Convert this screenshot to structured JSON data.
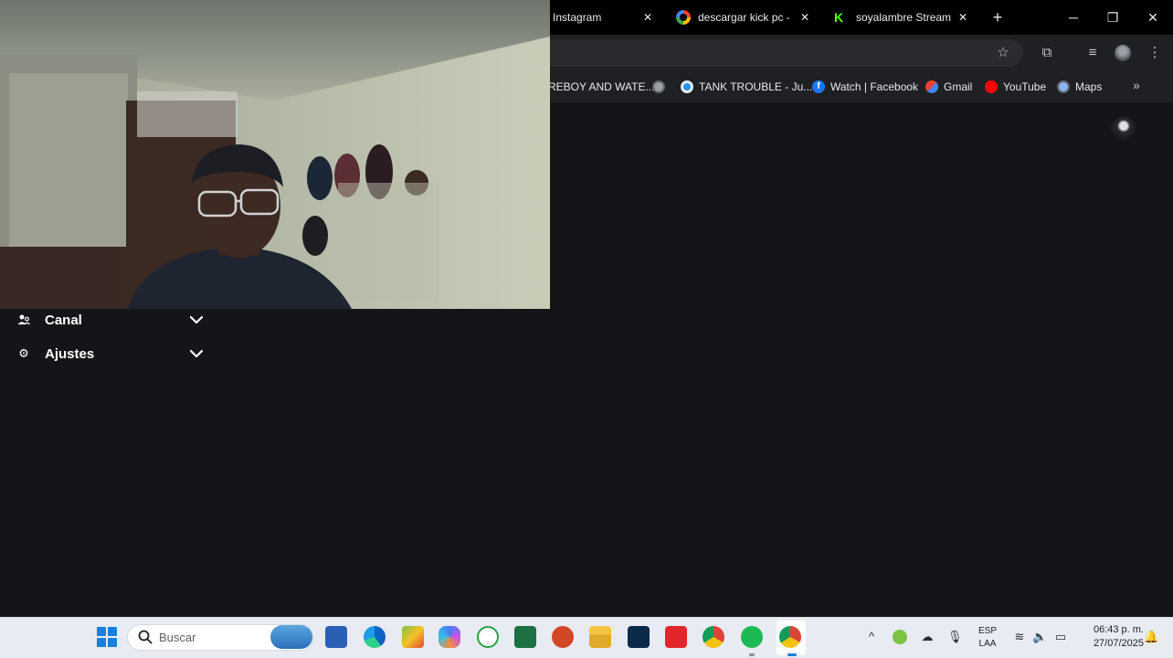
{
  "browser": {
    "tabs": [
      {
        "title": "Instagram"
      },
      {
        "title": "descargar kick pc - Búsqueda de Google"
      },
      {
        "title": "soyalambre Stream - Kick"
      }
    ]
  },
  "bookmarks": [
    {
      "label": "REBOY AND WATE..."
    },
    {
      "label": "TANK TROUBLE - Ju..."
    },
    {
      "label": "Watch | Facebook"
    },
    {
      "label": "Gmail"
    },
    {
      "label": "YouTube"
    },
    {
      "label": "Maps"
    }
  ],
  "sidebar": {
    "items": [
      {
        "label": "Canal",
        "icon": "users-icon"
      },
      {
        "label": "Ajustes",
        "icon": "gear-icon"
      }
    ]
  },
  "taskbar": {
    "search_placeholder": "Buscar",
    "language": "ESP",
    "layout": "LAA",
    "time": "06:43 p. m.",
    "date": "27/07/2025"
  },
  "colors": {
    "page_bg": "#141518",
    "kick_green": "#53fc18",
    "taskbar_bg": "#e8ebf2"
  }
}
